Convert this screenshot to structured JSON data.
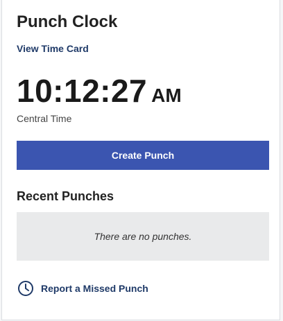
{
  "widget": {
    "title": "Punch Clock",
    "view_time_card_label": "View Time Card"
  },
  "clock": {
    "time": "10:12:27",
    "period": "AM",
    "timezone": "Central Time"
  },
  "actions": {
    "create_punch_label": "Create Punch"
  },
  "recent_punches": {
    "title": "Recent Punches",
    "empty_message": "There are no punches."
  },
  "report_missed": {
    "label": "Report a Missed Punch",
    "icon": "clock-icon"
  },
  "colors": {
    "accent": "#3b55b0",
    "link": "#1f3a68",
    "empty_bg": "#e9eaeb"
  }
}
